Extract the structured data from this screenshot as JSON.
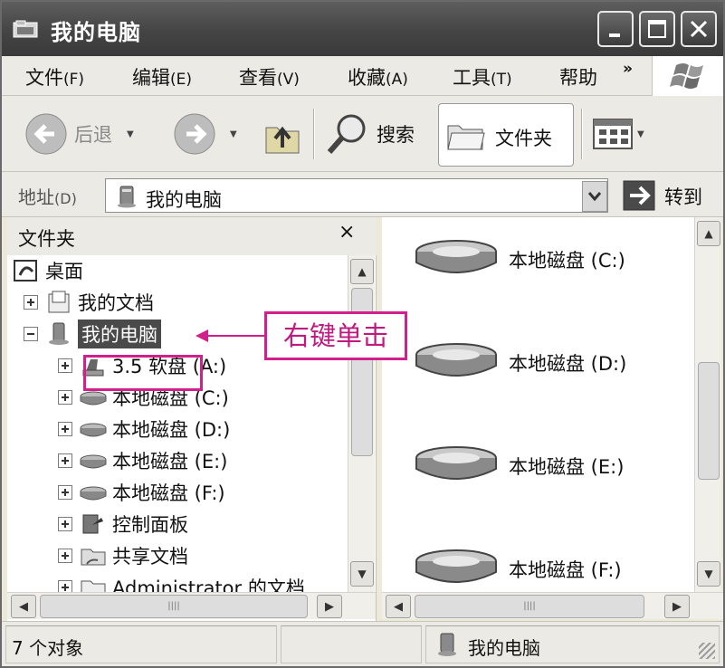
{
  "window": {
    "title": "我的电脑"
  },
  "menu": {
    "items": [
      {
        "label": "文件",
        "key": "(F)"
      },
      {
        "label": "编辑",
        "key": "(E)"
      },
      {
        "label": "查看",
        "key": "(V)"
      },
      {
        "label": "收藏",
        "key": "(A)"
      },
      {
        "label": "工具",
        "key": "(T)"
      },
      {
        "label": "帮助",
        "key": ""
      }
    ],
    "overflow": "»"
  },
  "toolbar": {
    "back": "后退",
    "search": "搜索",
    "folders": "文件夹"
  },
  "address": {
    "label": "地址",
    "key": "(D)",
    "value": "我的电脑",
    "go": "转到"
  },
  "folders_pane": {
    "title": "文件夹",
    "close": "×",
    "tree": [
      {
        "label": "桌面",
        "icon": "desktop-icon"
      },
      {
        "label": "我的文档",
        "icon": "documents-icon"
      },
      {
        "label": "我的电脑",
        "icon": "computer-icon",
        "selected": true
      },
      {
        "label": "3.5 软盘 (A:)",
        "icon": "floppy-icon"
      },
      {
        "label": "本地磁盘 (C:)",
        "icon": "drive-icon"
      },
      {
        "label": "本地磁盘 (D:)",
        "icon": "drive-icon"
      },
      {
        "label": "本地磁盘 (E:)",
        "icon": "drive-icon"
      },
      {
        "label": "本地磁盘 (F:)",
        "icon": "drive-icon"
      },
      {
        "label": "控制面板",
        "icon": "control-panel-icon"
      },
      {
        "label": "共享文档",
        "icon": "shared-folder-icon"
      },
      {
        "label": "Administrator 的文档",
        "icon": "folder-icon"
      }
    ]
  },
  "content": {
    "drives": [
      "本地磁盘 (C:)",
      "本地磁盘 (D:)",
      "本地磁盘 (E:)",
      "本地磁盘 (F:)"
    ]
  },
  "annotation": {
    "text": "右键单击",
    "color": "#d1208c"
  },
  "status": {
    "count": "7 个对象",
    "location": "我的电脑"
  }
}
